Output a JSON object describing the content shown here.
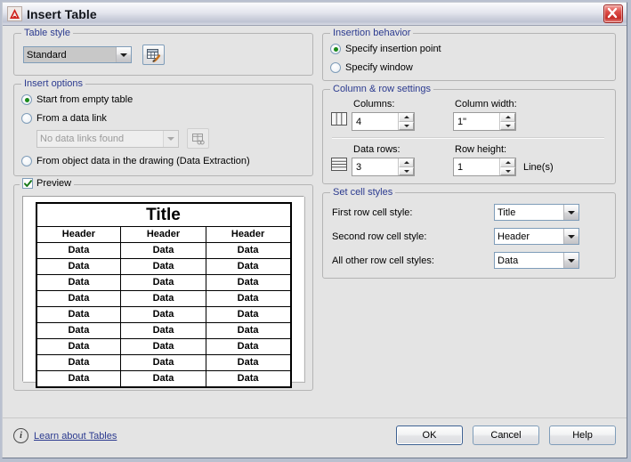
{
  "window": {
    "title": "Insert Table",
    "logo_icon": "autocad-logo-icon",
    "close_icon": "close-icon"
  },
  "table_style": {
    "legend": "Table style",
    "selected": "Standard",
    "manage_button_icon": "table-style-edit-icon"
  },
  "insert_options": {
    "legend": "Insert options",
    "options": [
      {
        "label": "Start from empty table",
        "selected": true
      },
      {
        "label": "From a data link",
        "selected": false
      },
      {
        "label": "From object data in the drawing (Data Extraction)",
        "selected": false
      }
    ],
    "data_link_combo": {
      "value": "No data links found",
      "disabled": true
    },
    "data_link_button_icon": "data-link-manager-icon"
  },
  "preview": {
    "legend": "Preview",
    "checked": true,
    "table": {
      "title_row": "Title",
      "header_row": [
        "Header",
        "Header",
        "Header"
      ],
      "data_rows": [
        [
          "Data",
          "Data",
          "Data"
        ],
        [
          "Data",
          "Data",
          "Data"
        ],
        [
          "Data",
          "Data",
          "Data"
        ],
        [
          "Data",
          "Data",
          "Data"
        ],
        [
          "Data",
          "Data",
          "Data"
        ],
        [
          "Data",
          "Data",
          "Data"
        ],
        [
          "Data",
          "Data",
          "Data"
        ],
        [
          "Data",
          "Data",
          "Data"
        ],
        [
          "Data",
          "Data",
          "Data"
        ]
      ]
    }
  },
  "insertion_behavior": {
    "legend": "Insertion behavior",
    "options": [
      {
        "label": "Specify insertion point",
        "selected": true
      },
      {
        "label": "Specify window",
        "selected": false
      }
    ]
  },
  "column_row_settings": {
    "legend": "Column & row settings",
    "columns": {
      "label": "Columns:",
      "value": "4",
      "icon": "columns-icon"
    },
    "column_width": {
      "label": "Column width:",
      "value": "1\""
    },
    "data_rows": {
      "label": "Data rows:",
      "value": "3",
      "icon": "rows-icon"
    },
    "row_height": {
      "label": "Row height:",
      "value": "1",
      "unit": "Line(s)"
    }
  },
  "set_cell_styles": {
    "legend": "Set cell styles",
    "rows": [
      {
        "label": "First row cell style:",
        "value": "Title"
      },
      {
        "label": "Second row cell style:",
        "value": "Header"
      },
      {
        "label": "All other row cell styles:",
        "value": "Data"
      }
    ]
  },
  "footer": {
    "info_icon": "info-icon",
    "info_glyph": "i",
    "learn_link": "Learn about Tables",
    "ok": "OK",
    "cancel": "Cancel",
    "help": "Help"
  }
}
